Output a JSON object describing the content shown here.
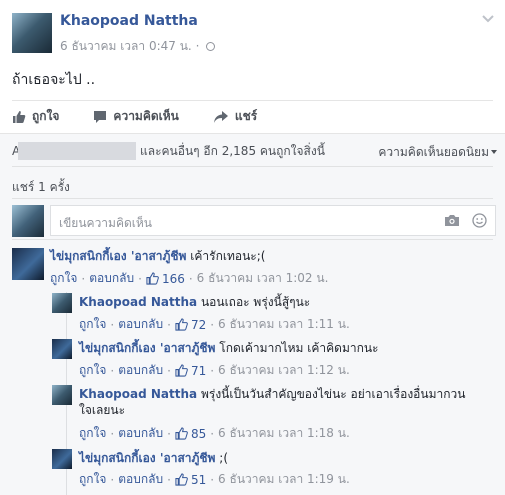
{
  "post": {
    "author": "Khaopoad Nattha",
    "timestamp": "6 ธันวาคม เวลา 0:47 น.",
    "meta_sep": "·",
    "privacy_icon": "globe-icon",
    "text": "ถ้าเธอจะไป .."
  },
  "actions": {
    "like": "ถูกใจ",
    "comment": "ความคิดเห็น",
    "share": "แชร์"
  },
  "feedback": {
    "likes_prefix": "A",
    "likes_text": "และคนอื่นๆ อีก 2,185 คนถูกใจสิ่งนี้",
    "sort_label": "ความคิดเห็นยอดนิยม",
    "shares": "แชร์ 1 ครั้ง",
    "comment_placeholder": "เขียนความคิดเห็น",
    "accent_color": "#365899"
  },
  "comments": [
    {
      "author": "ไข่มุกสนิกกี้เอง 'อาสาภู้ชีพ",
      "text": "เค้ารักเทอนะ;(",
      "like": "ถูกใจ",
      "reply": "ตอบกลับ",
      "likes": "166",
      "time": "6 ธันวาคม เวลา 1:02 น."
    },
    {
      "author": "Khaopoad Nattha",
      "text": "นอนเถอะ พรุ่งนี้สู้ๆนะ",
      "like": "ถูกใจ",
      "reply": "ตอบกลับ",
      "likes": "72",
      "time": "6 ธันวาคม เวลา 1:11 น."
    },
    {
      "author": "ไข่มุกสนิกกี้เอง 'อาสาภู้ชีพ",
      "text": "โกดเค้ามากไหม เค้าคิดมากนะ",
      "like": "ถูกใจ",
      "reply": "ตอบกลับ",
      "likes": "71",
      "time": "6 ธันวาคม เวลา 1:12 น."
    },
    {
      "author": "Khaopoad Nattha",
      "text": "พรุ่งนี้เป็นวันสำคัญของไข่นะ อย่าเอาเรื่องอื่นมากวนใจเลยนะ",
      "like": "ถูกใจ",
      "reply": "ตอบกลับ",
      "likes": "85",
      "time": "6 ธันวาคม เวลา 1:18 น."
    },
    {
      "author": "ไข่มุกสนิกกี้เอง 'อาสาภู้ชีพ",
      "text": ";(",
      "like": "ถูกใจ",
      "reply": "ตอบกลับ",
      "likes": "51",
      "time": "6 ธันวาคม เวลา 1:19 น."
    }
  ],
  "meta_dot": "·"
}
